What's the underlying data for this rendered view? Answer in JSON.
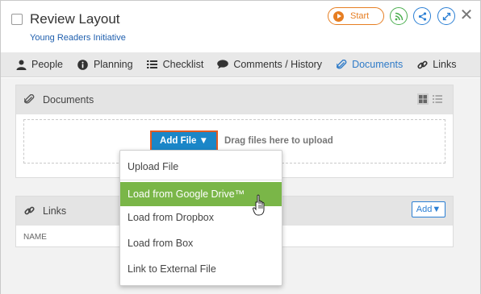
{
  "task": {
    "title": "Review Layout",
    "subtitle": "Young Readers Initiative",
    "start_label": "Start"
  },
  "nav": {
    "items": [
      {
        "label": "People",
        "icon": "person-icon"
      },
      {
        "label": "Planning",
        "icon": "info-icon"
      },
      {
        "label": "Checklist",
        "icon": "list-icon"
      },
      {
        "label": "Comments / History",
        "icon": "comment-icon"
      },
      {
        "label": "Documents",
        "icon": "paperclip-icon",
        "active": true
      },
      {
        "label": "Links",
        "icon": "link-icon"
      }
    ]
  },
  "documents": {
    "title": "Documents",
    "add_file_label": "Add File ▼",
    "drag_text": "Drag files here to upload"
  },
  "links": {
    "title": "Links",
    "add_label": "Add▼",
    "column_name": "NAME"
  },
  "add_menu": {
    "items": [
      "Upload File",
      "Load from Google Drive™",
      "Load from Dropbox",
      "Load from Box",
      "Link to External File"
    ],
    "highlighted_index": 1
  },
  "colors": {
    "accent": "#2f7bc8",
    "start_orange": "#e67e22",
    "highlight_green": "#7ab648",
    "add_file_blue": "#1a86c8"
  }
}
